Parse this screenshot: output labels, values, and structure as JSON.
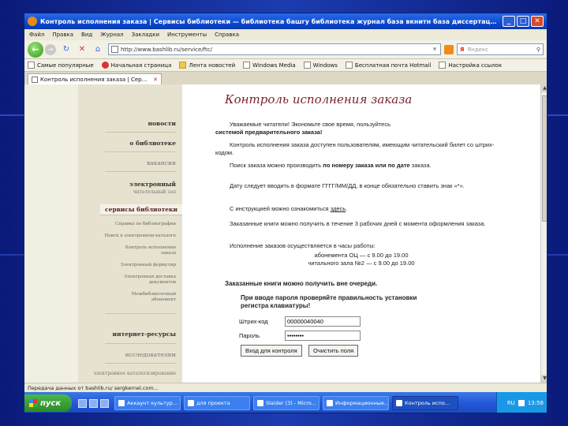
{
  "window": {
    "title": "Контроль исполнения заказа | Сервисы библиотеки — библиотека башгу библиотека журнал база вкнитн база диссертаций рефератнени ...",
    "minimize": "_",
    "maximize": "□",
    "close": "✕"
  },
  "menu": [
    "Файл",
    "Правка",
    "Вид",
    "Журнал",
    "Закладки",
    "Инструменты",
    "Справка"
  ],
  "nav": {
    "url": "http://www.bashlib.ru/service/ftc/",
    "search_placeholder": "Яндекс",
    "search_brand": "Я"
  },
  "bookmarks": [
    {
      "label": "Самые популярные",
      "icon": "page"
    },
    {
      "label": "Начальная страница",
      "icon": "dot"
    },
    {
      "label": "Лента новостей",
      "icon": "folder"
    },
    {
      "label": "Windows Media",
      "icon": "page"
    },
    {
      "label": "Windows",
      "icon": "page"
    },
    {
      "label": "Бесплатная почта Hotmail",
      "icon": "page"
    },
    {
      "label": "Настройка ссылок",
      "icon": "page"
    }
  ],
  "tab": {
    "label": "Контроль исполнения заказа | Сер..."
  },
  "sidebar": {
    "items": [
      {
        "label": "новости",
        "style": "bold"
      },
      {
        "label": "о библиотеке",
        "style": "bold"
      },
      {
        "label": "вакансии",
        "style": "muted"
      },
      {
        "label": "электронный",
        "style": "bold"
      },
      {
        "label": "читательный зал",
        "style": "muted"
      },
      {
        "label": "сервисы библиотеки",
        "style": "active"
      },
      {
        "label": "Справка по библиографии",
        "style": "sub"
      },
      {
        "label": "Поиск в электронном каталоге",
        "style": "sub"
      },
      {
        "label": "Контроль исполнения",
        "style": "sub"
      },
      {
        "label": "заказа",
        "style": "sub"
      },
      {
        "label": "Электронный формуляр",
        "style": "sub"
      },
      {
        "label": "Электронная доставка",
        "style": "sub"
      },
      {
        "label": "документов",
        "style": "sub"
      },
      {
        "label": "Межбиблиотечный",
        "style": "sub"
      },
      {
        "label": "абонемент",
        "style": "sub"
      },
      {
        "label": "интернет-ресурсы",
        "style": "bold"
      },
      {
        "label": "исследователям",
        "style": "muted"
      },
      {
        "label": "электронное каталогизирование",
        "style": "muted"
      }
    ]
  },
  "main": {
    "title": "Контроль исполнения заказа",
    "p1a": "Уважаемые читатели! Экономьте свое время, пользуйтесь",
    "p1b": "системой предварительного заказа!",
    "p2": "Контроль исполнения заказа доступен пользователям, имеющим читательский билет со штрих-кодом.",
    "p3a": "Поиск заказа можно производить ",
    "p3b": "по номеру заказа или по дате",
    "p3c": " заказа.",
    "p4": "Дату следует вводить в формате ГГГГ/ММ/ДД, в конце обязательно ставить знак «*».",
    "p5a": "С инструкцией можно ознакомиться ",
    "p5link": "здесь",
    "p6": "Заказанные книги можно получить в течение 3 рабочих дней с момента оформления заказа.",
    "p7": "Исполнение заказов осуществляется в часы работы:",
    "hours1": "абонемента ОЦ — с 9.00 до 19.00",
    "hours2": "читального зала №2 — с 9.00 до 19.00",
    "note1": "Заказанные книги можно получить вне очереди.",
    "note2a": "При вводе пароля проверяйте правильность установки",
    "note2b": "регистра клавиатуры!",
    "barcode_label": "Штрих-код",
    "barcode_value": "00000040040",
    "password_label": "Пароль",
    "password_value": "••••••••",
    "submit": "Вход для контроля",
    "reset": "Очистить поля"
  },
  "status": {
    "text": "Передача данных от bashlib.ru/ sergkernel.com..."
  },
  "taskbar": {
    "start": "пуск",
    "tasks": [
      "Аккаунт культур...",
      "для проекта",
      "Slaider (3) - Micro...",
      "Информационные...",
      "Контроль испо..."
    ],
    "lang": "RU",
    "clock": "13:58"
  }
}
